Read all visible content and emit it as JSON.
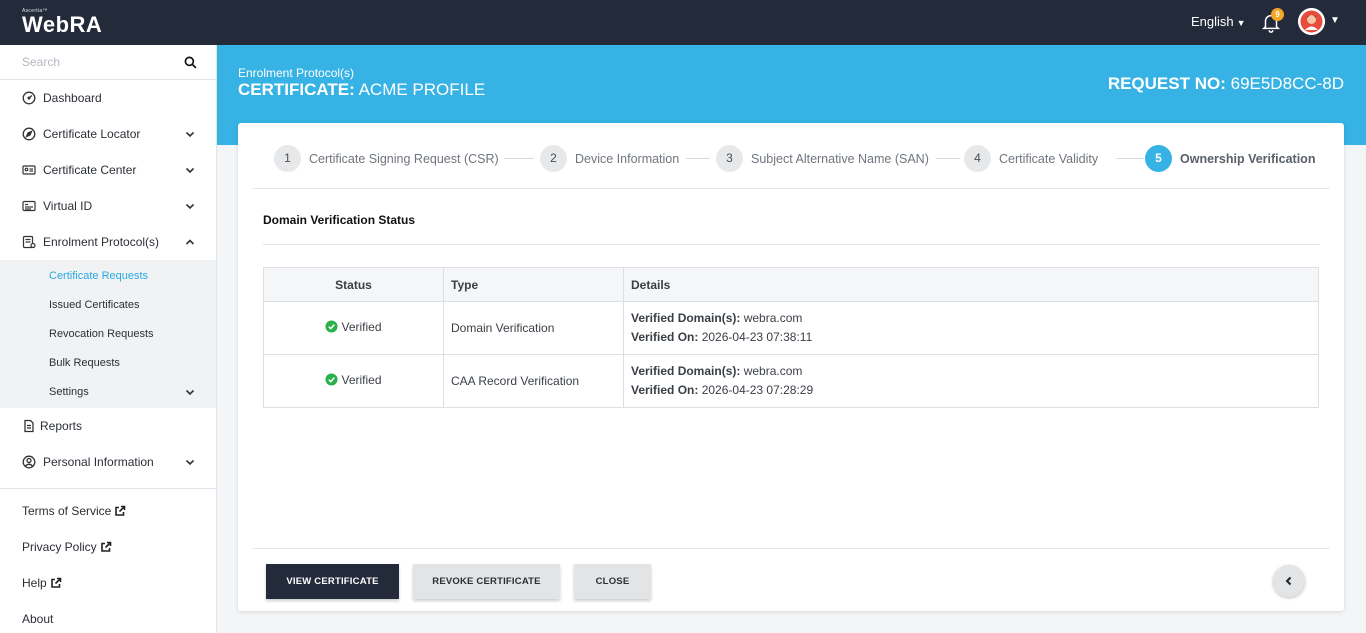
{
  "app": {
    "logo_tagline": "Ascertia™",
    "logo_name": "WebRA",
    "language": "English",
    "notification_count": "9"
  },
  "sidebar": {
    "search_placeholder": "Search",
    "items": [
      {
        "label": "Dashboard",
        "icon": "dashboard-icon"
      },
      {
        "label": "Certificate Locator",
        "icon": "compass-icon"
      },
      {
        "label": "Certificate Center",
        "icon": "id-card-icon"
      },
      {
        "label": "Virtual ID",
        "icon": "virtual-id-icon"
      },
      {
        "label": "Enrolment Protocol(s)",
        "icon": "enrolment-icon"
      }
    ],
    "sub_items": [
      {
        "label": "Certificate Requests"
      },
      {
        "label": "Issued Certificates"
      },
      {
        "label": "Revocation Requests"
      },
      {
        "label": "Bulk Requests"
      },
      {
        "label": "Settings"
      }
    ],
    "items_after": [
      {
        "label": "Reports",
        "icon": "document-icon"
      },
      {
        "label": "Personal Information",
        "icon": "user-circle-icon"
      }
    ],
    "footer": [
      {
        "label": "Terms of Service"
      },
      {
        "label": "Privacy Policy"
      },
      {
        "label": "Help"
      },
      {
        "label": "About"
      }
    ]
  },
  "header": {
    "breadcrumb": "Enrolment Protocol(s)",
    "title_prefix": "CERTIFICATE:",
    "title_value": "ACME PROFILE",
    "request_label": "REQUEST NO:",
    "request_value": "69E5D8CC-8D"
  },
  "stepper": {
    "steps": [
      {
        "number": "1",
        "label": "Certificate Signing Request (CSR)"
      },
      {
        "number": "2",
        "label": "Device Information"
      },
      {
        "number": "3",
        "label": "Subject Alternative Name (SAN)"
      },
      {
        "number": "4",
        "label": "Certificate Validity"
      },
      {
        "number": "5",
        "label": "Ownership Verification"
      }
    ],
    "active_step": 5
  },
  "verification": {
    "section_title": "Domain Verification Status",
    "columns": [
      "Status",
      "Type",
      "Details"
    ],
    "rows": [
      {
        "status": "Verified",
        "type": "Domain Verification",
        "detail1_label": "Verified Domain(s):",
        "detail1_value": " webra.com",
        "detail2_label": "Verified On:",
        "detail2_value": "2026-04-23 07:38:11"
      },
      {
        "status": "Verified",
        "type": "CAA Record Verification",
        "detail1_label": "Verified Domain(s):",
        "detail1_value": "webra.com",
        "detail2_label": "Verified On:",
        "detail2_value": "2026-04-23 07:28:29"
      }
    ]
  },
  "actions": {
    "view_certificate": "VIEW CERTIFICATE",
    "revoke_certificate": "REVOKE CERTIFICATE",
    "close": "CLOSE"
  },
  "colors": {
    "topbar": "#232a3a",
    "accent": "#36b3e4",
    "verified_green": "#2bb04a",
    "badge": "#f5a623"
  }
}
